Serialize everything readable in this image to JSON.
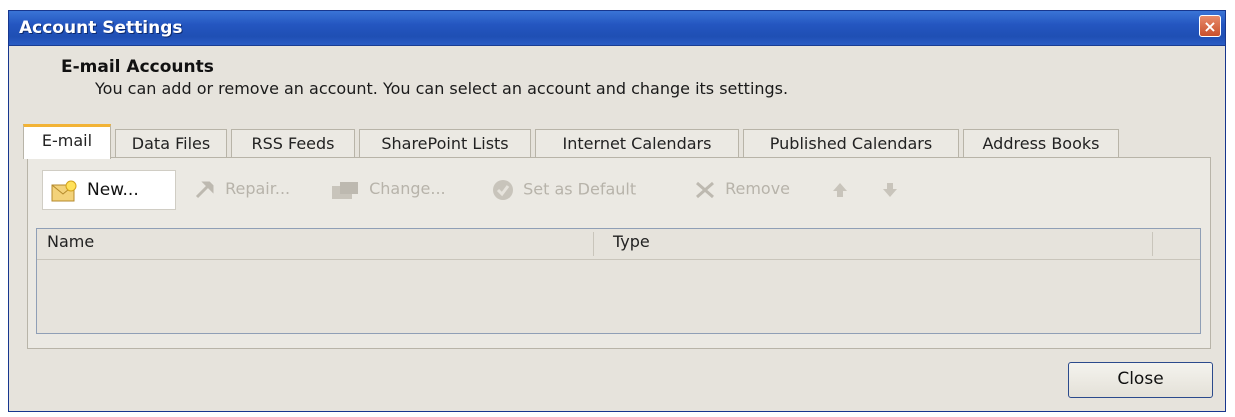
{
  "window": {
    "title": "Account Settings",
    "close_glyph": "×"
  },
  "header": {
    "title": "E-mail Accounts",
    "subtitle": "You can add or remove an account. You can select an account and change its settings."
  },
  "tabs": [
    {
      "label": "E-mail",
      "active": true
    },
    {
      "label": "Data Files"
    },
    {
      "label": "RSS Feeds"
    },
    {
      "label": "SharePoint Lists"
    },
    {
      "label": "Internet Calendars"
    },
    {
      "label": "Published Calendars"
    },
    {
      "label": "Address Books"
    }
  ],
  "toolbar": {
    "new_label": "New...",
    "repair_label": "Repair...",
    "change_label": "Change...",
    "default_label": "Set as Default",
    "remove_label": "Remove"
  },
  "list": {
    "columns": [
      "Name",
      "Type"
    ]
  },
  "footer": {
    "close_label": "Close"
  },
  "colors": {
    "title_bar": "#2456c0",
    "active_tab_accent": "#f2b336",
    "disabled_text": "#b7b3aa"
  }
}
